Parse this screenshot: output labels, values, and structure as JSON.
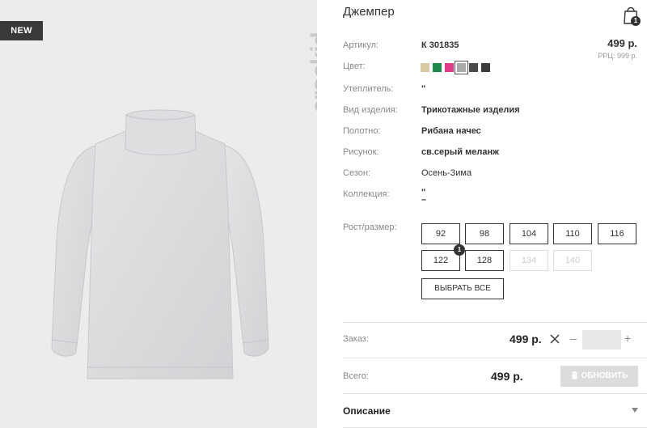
{
  "badge_new": "NEW",
  "brand_logo": "crockid",
  "product": {
    "title": "Джемпер",
    "price": "499 р.",
    "rrc": "РРЦ: 999 р.",
    "cart_count": "1"
  },
  "attributes": [
    {
      "label": "Артикул:",
      "value": "К 301835"
    },
    {
      "label": "Цвет:",
      "value": ""
    },
    {
      "label": "Утеплитель:",
      "value": "\""
    },
    {
      "label": "Вид изделия:",
      "value": "Трикотажные изделия"
    },
    {
      "label": "Полотно:",
      "value": "Рибана начес"
    },
    {
      "label": "Рисунок:",
      "value": "св.серый меланж"
    },
    {
      "label": "Сезон:",
      "value": "Осень-Зима"
    },
    {
      "label": "Коллекция:",
      "value": "\"\n–"
    }
  ],
  "colors": [
    "#d7c9a3",
    "#1f8a4c",
    "#e23b87",
    "#a9a9a9",
    "#4a4a4a",
    "#3b3b3b"
  ],
  "selected_color_index": 3,
  "sizes": {
    "label": "Рост/размер:",
    "items": [
      "92",
      "98",
      "104",
      "110",
      "116",
      "122",
      "128",
      "134",
      "140"
    ],
    "disabled": [
      "134",
      "140"
    ],
    "selected": "122",
    "selected_count": "1",
    "select_all_label": "ВЫБРАТЬ ВСЕ"
  },
  "order": {
    "label": "Заказ:",
    "price": "499 р.",
    "quantity": "",
    "minus": "–",
    "plus": "+"
  },
  "total": {
    "label": "Всего:",
    "price": "499 р.",
    "update_label": "ОБНОВИТЬ"
  },
  "description_label": "Описание"
}
